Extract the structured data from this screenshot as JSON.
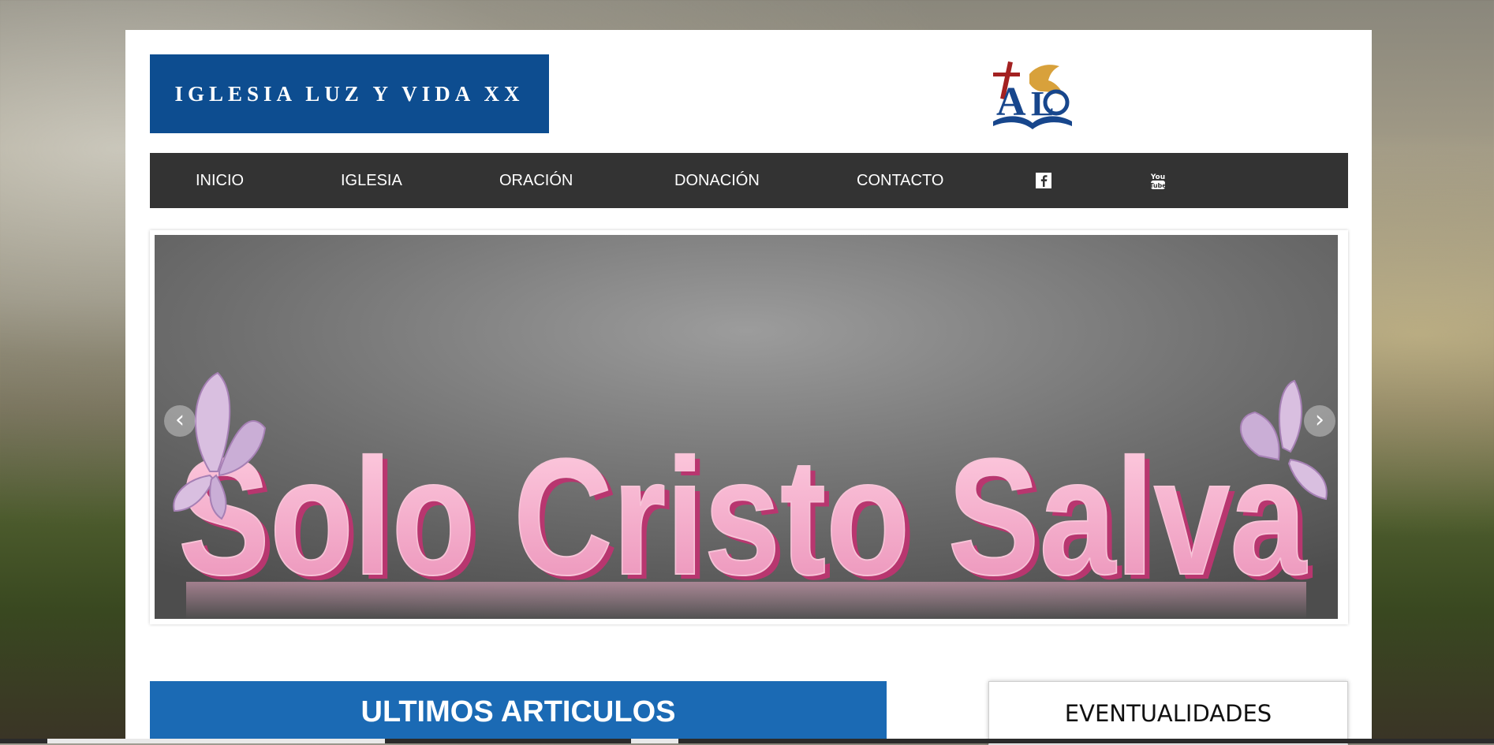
{
  "header": {
    "site_title": "IGLESIA LUZ Y VIDA XX",
    "logo_icon": "church-logo-icon"
  },
  "nav": {
    "items": [
      {
        "label": "INICIO"
      },
      {
        "label": "IGLESIA"
      },
      {
        "label": "ORACIÓN"
      },
      {
        "label": "DONACIÓN"
      },
      {
        "label": "CONTACTO"
      }
    ],
    "social": [
      {
        "icon": "facebook-icon"
      },
      {
        "icon": "youtube-icon",
        "text": "You Tube"
      }
    ],
    "background": "#333333"
  },
  "slider": {
    "slide_text": "Solo Cristo Salva",
    "prev_icon": "chevron-left-icon",
    "next_icon": "chevron-right-icon"
  },
  "sections": {
    "articles_title": "ULTIMOS ARTICULOS",
    "events_title": "EVENTUALIDADES"
  },
  "colors": {
    "brand_blue": "#0d4d90",
    "section_blue": "#1b6ab4",
    "slide_text_pink": "#f2a3c4"
  }
}
